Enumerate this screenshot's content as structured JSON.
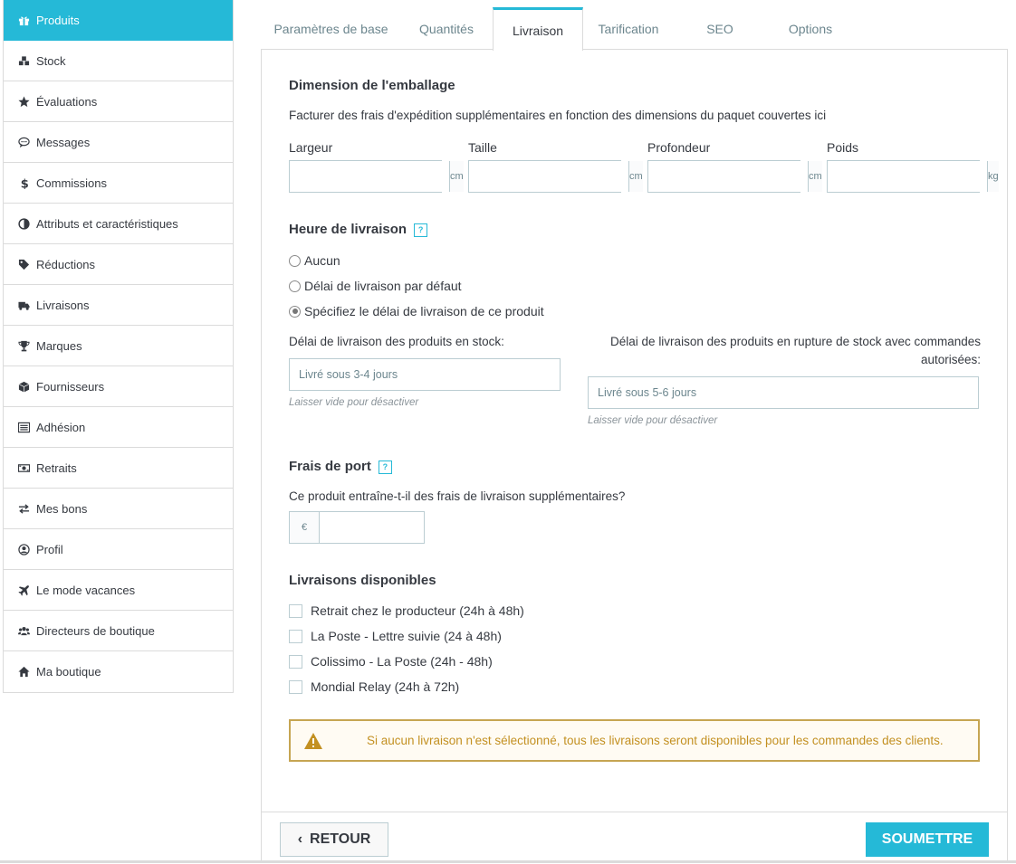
{
  "sidebar": {
    "items": [
      {
        "label": "Produits",
        "icon": "gift-icon",
        "active": true
      },
      {
        "label": "Stock",
        "icon": "cubes-icon"
      },
      {
        "label": "Évaluations",
        "icon": "star-icon"
      },
      {
        "label": "Messages",
        "icon": "comment-icon"
      },
      {
        "label": "Commissions",
        "icon": "dollar-icon"
      },
      {
        "label": "Attributs et caractéristiques",
        "icon": "adjust-icon"
      },
      {
        "label": "Réductions",
        "icon": "tag-icon"
      },
      {
        "label": "Livraisons",
        "icon": "truck-icon"
      },
      {
        "label": "Marques",
        "icon": "trophy-icon"
      },
      {
        "label": "Fournisseurs",
        "icon": "cube-icon"
      },
      {
        "label": "Adhésion",
        "icon": "list-icon"
      },
      {
        "label": "Retraits",
        "icon": "money-icon"
      },
      {
        "label": "Mes bons",
        "icon": "exchange-icon"
      },
      {
        "label": "Profil",
        "icon": "user-circle-icon"
      },
      {
        "label": "Le mode vacances",
        "icon": "plane-icon"
      },
      {
        "label": "Directeurs de boutique",
        "icon": "users-icon"
      },
      {
        "label": "Ma boutique",
        "icon": "home-icon"
      }
    ]
  },
  "tabs": [
    {
      "label": "Paramètres de base"
    },
    {
      "label": "Quantités"
    },
    {
      "label": "Livraison",
      "active": true
    },
    {
      "label": "Tarification"
    },
    {
      "label": "SEO"
    },
    {
      "label": "Options"
    }
  ],
  "package": {
    "title": "Dimension de l'emballage",
    "description": "Facturer des frais d'expédition supplémentaires en fonction des dimensions du paquet couvertes ici",
    "fields": [
      {
        "label": "Largeur",
        "unit": "cm",
        "value": ""
      },
      {
        "label": "Taille",
        "unit": "cm",
        "value": ""
      },
      {
        "label": "Profondeur",
        "unit": "cm",
        "value": ""
      },
      {
        "label": "Poids",
        "unit": "kg",
        "value": ""
      }
    ]
  },
  "delivery_time": {
    "title": "Heure de livraison",
    "help": "?",
    "options": [
      {
        "label": "Aucun",
        "selected": false
      },
      {
        "label": "Délai de livraison par défaut",
        "selected": false
      },
      {
        "label": "Spécifiez le délai de livraison de ce produit",
        "selected": true
      }
    ],
    "in_stock_label": "Délai de livraison des produits en stock:",
    "in_stock_placeholder": "Livré sous 3-4 jours",
    "in_stock_hint": "Laisser vide pour désactiver",
    "out_stock_label_line1": "Délai de livraison des produits en rupture de stock avec commandes",
    "out_stock_label_line2": "autorisées:",
    "out_stock_placeholder": "Livré sous 5-6 jours",
    "out_stock_hint": "Laisser vide pour désactiver"
  },
  "shipping_fees": {
    "title": "Frais de port",
    "help": "?",
    "question": "Ce produit entraîne-t-il des frais de livraison supplémentaires?",
    "currency": "€",
    "value": ""
  },
  "carriers": {
    "title": "Livraisons disponibles",
    "items": [
      {
        "label": "Retrait chez le producteur (24h à 48h)",
        "checked": false
      },
      {
        "label": "La Poste - Lettre suivie (24 à 48h)",
        "checked": false
      },
      {
        "label": "Colissimo - La Poste (24h - 48h)",
        "checked": false
      },
      {
        "label": "Mondial Relay (24h à 72h)",
        "checked": false
      }
    ],
    "warning": "Si aucun livraison n'est sélectionné, tous les livraisons seront disponibles pour les commandes des clients."
  },
  "footer": {
    "back_label": "RETOUR",
    "back_icon": "‹",
    "submit_label": "SOUMETTRE"
  },
  "colors": {
    "accent": "#25b9d7",
    "warning": "#c39021"
  }
}
